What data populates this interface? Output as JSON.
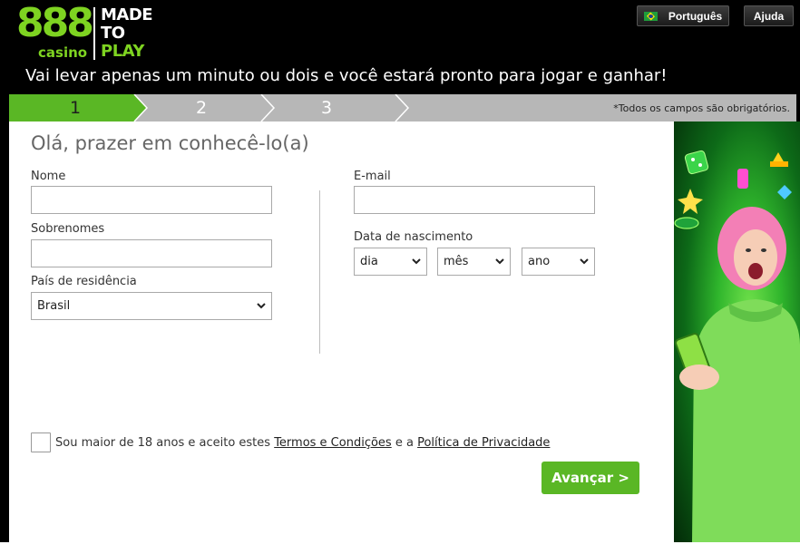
{
  "brand": {
    "logo_number": "888",
    "logo_sub": "casino",
    "slogan_line1": "MADE",
    "slogan_line2": "TO",
    "slogan_line3": "PLAY",
    "accent_color": "#7ed321"
  },
  "header": {
    "language_label": "Português",
    "help_label": "Ajuda",
    "tagline": "Vai levar apenas um minuto ou dois e você estará pronto para jogar e ganhar!"
  },
  "steps": {
    "items": [
      "1",
      "2",
      "3"
    ],
    "active": 1,
    "required_note": "*Todos os campos são obrigatórios."
  },
  "form": {
    "greeting": "Olá, prazer em conhecê-lo(a)",
    "first_name_label": "Nome",
    "first_name_value": "",
    "last_name_label": "Sobrenomes",
    "last_name_value": "",
    "country_label": "País de residência",
    "country_value": "Brasil",
    "email_label": "E-mail",
    "email_value": "",
    "dob_label": "Data de nascimento",
    "dob_day": "dia",
    "dob_month": "mês",
    "dob_year": "ano",
    "terms_checked": false,
    "terms_prefix": "Sou maior de 18 anos e aceito estes ",
    "terms_link": "Termos e Condições",
    "terms_mid": " e a ",
    "privacy_link": "Política de Privacidade",
    "next_label": "Avançar >"
  },
  "colors": {
    "step_active": "#5ab725",
    "step_inactive": "#b7b7b7",
    "button_green": "#5ab725"
  },
  "icons": {
    "flag": "brazil-flag-icon",
    "dropdown": "chevron-down-icon",
    "step_arrow": "chevron-right-icon"
  }
}
